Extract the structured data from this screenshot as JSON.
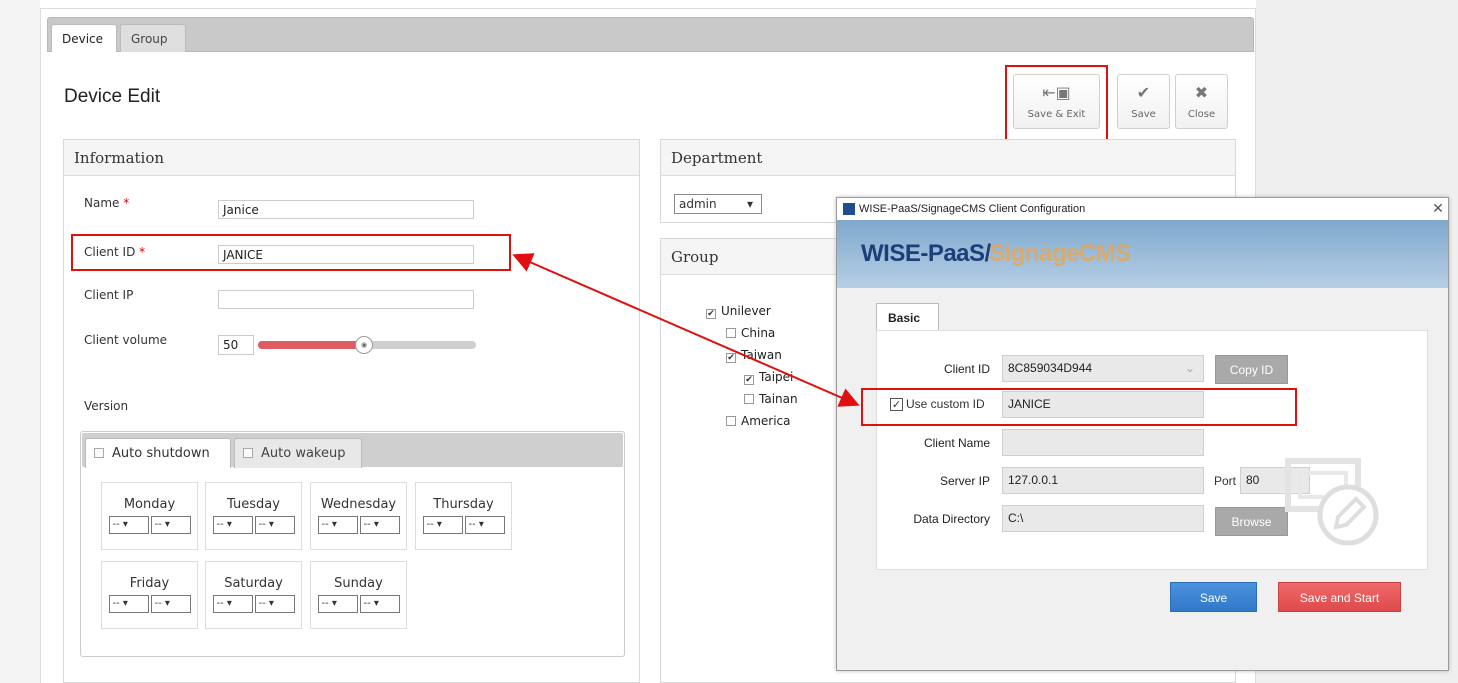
{
  "tabs": [
    "Device",
    "Group"
  ],
  "page_title": "Device Edit",
  "toolbar": {
    "save_exit": "Save & Exit",
    "save": "Save",
    "close": "Close"
  },
  "info": {
    "title": "Information",
    "name_label": "Name",
    "name_value": "Janice",
    "client_id_label": "Client ID",
    "client_id_value": "JANICE",
    "client_ip_label": "Client IP",
    "client_ip_value": "",
    "volume_label": "Client volume",
    "volume_value": "50",
    "volume_level": 0.5,
    "required_mark": "*",
    "version_label": "Version",
    "schedule_tabs": [
      "Auto shutdown",
      "Auto wakeup"
    ],
    "days": [
      "Monday",
      "Tuesday",
      "Wednesday",
      "Thursday",
      "Friday",
      "Saturday",
      "Sunday"
    ],
    "select_value": "--"
  },
  "department": {
    "title": "Department",
    "selected": "admin"
  },
  "group": {
    "title": "Group",
    "tree": [
      {
        "label": "Unilever",
        "checked": true
      },
      {
        "label": "China",
        "checked": false
      },
      {
        "label": "Taiwan",
        "checked": true
      },
      {
        "label": "Taipei",
        "checked": true
      },
      {
        "label": "Tainan",
        "checked": false
      },
      {
        "label": "America",
        "checked": false
      }
    ]
  },
  "dialog": {
    "title": "WISE-PaaS/SignageCMS Client Configuration",
    "banner_part1": "WISE-PaaS/",
    "banner_part2": "SignageCMS",
    "tab": "Basic",
    "client_id_label": "Client ID",
    "client_id_value": "8C859034D944",
    "copy_id": "Copy ID",
    "use_custom_label": "Use custom ID",
    "custom_id_value": "JANICE",
    "client_name_label": "Client Name",
    "client_name_value": "",
    "server_ip_label": "Server IP",
    "server_ip_value": "127.0.0.1",
    "port_label": "Port",
    "port_value": "80",
    "data_dir_label": "Data Directory",
    "data_dir_value": "C:\\",
    "browse": "Browse",
    "save": "Save",
    "save_start": "Save and Start"
  },
  "colors": {
    "highlight": "#e01010",
    "slider": "#e05b62",
    "save_blue": "#3a84d4",
    "start_red": "#e65556"
  }
}
